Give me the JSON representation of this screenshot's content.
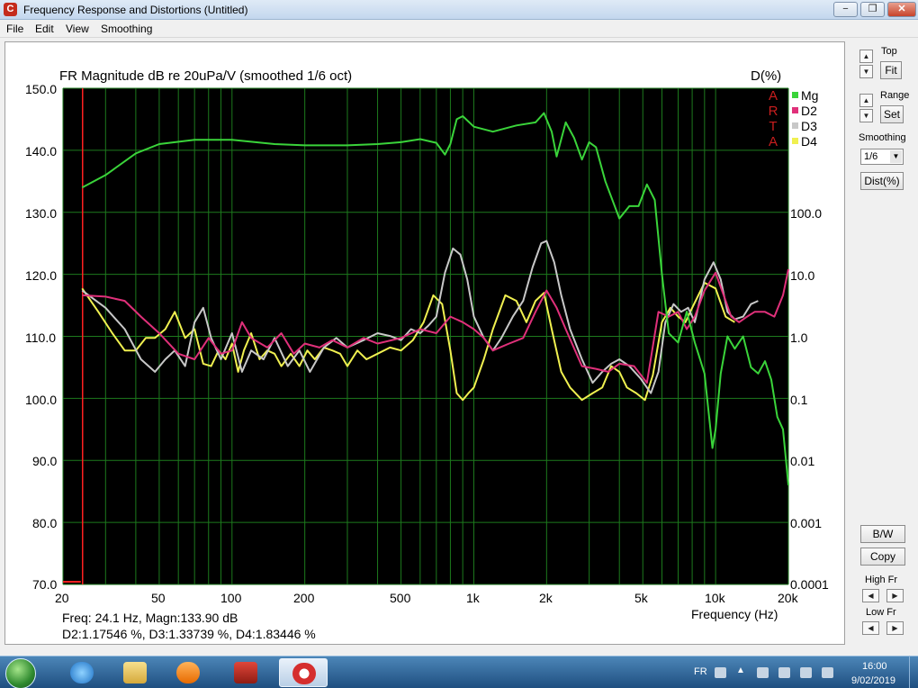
{
  "window": {
    "title": "Frequency Response and Distortions (Untitled)"
  },
  "titlebar_buttons": {
    "minimize": "−",
    "maximize": "❐",
    "close": "✕"
  },
  "menu": [
    "File",
    "Edit",
    "View",
    "Smoothing"
  ],
  "plot": {
    "title": "FR Magnitude dB re 20uPa/V (smoothed 1/6 oct)",
    "right_axis_label": "D(%)",
    "x_axis_label": "Frequency (Hz)",
    "arta_letters": [
      "A",
      "R",
      "T",
      "A"
    ],
    "left_ticks": [
      "150.0",
      "140.0",
      "130.0",
      "120.0",
      "110.0",
      "100.0",
      "90.0",
      "80.0",
      "70.0"
    ],
    "right_ticks": [
      "100.0",
      "10.0",
      "1.0",
      "0.1",
      "0.01",
      "0.001",
      "0.0001"
    ],
    "x_ticks": [
      "20",
      "50",
      "100",
      "200",
      "500",
      "1k",
      "2k",
      "5k",
      "10k",
      "20k"
    ],
    "readout_line1": "Freq: 24.1 Hz, Magn:133.90 dB",
    "readout_line2": "D2:1.17546 %, D3:1.33739 %, D4:1.83446 %",
    "colors": {
      "background": "#000000",
      "grid": "#1d7a1d",
      "cursor": "#ff2020",
      "Mg": "#3ad43a",
      "D2": "#e0307a",
      "D3": "#c8c8c8",
      "D4": "#f0f050"
    }
  },
  "side_panel": {
    "top_label": "Top",
    "fit_button": "Fit",
    "range_label": "Range",
    "set_button": "Set",
    "smoothing_label": "Smoothing",
    "smoothing_value": "1/6",
    "dist_button": "Dist(%)",
    "bw_button": "B/W",
    "copy_button": "Copy",
    "high_fr_label": "High Fr",
    "low_fr_label": "Low Fr"
  },
  "taskbar": {
    "lang": "FR",
    "time": "16:00",
    "date": "9/02/2019"
  },
  "chart_data": {
    "type": "line",
    "title": "FR Magnitude dB re 20uPa/V (smoothed 1/6 oct)",
    "xlabel": "Frequency (Hz)",
    "ylabel": "",
    "y2label": "D(%)",
    "x_scale": "log",
    "xlim": [
      20,
      20000
    ],
    "ylim": [
      70,
      150
    ],
    "y2_scale": "log",
    "y2lim": [
      0.0001,
      1000
    ],
    "grid": true,
    "legend": "top-right",
    "cursor_x": 24.1,
    "series": [
      {
        "name": "Mg",
        "axis": "left",
        "x": [
          24,
          30,
          40,
          50,
          70,
          100,
          150,
          200,
          300,
          400,
          500,
          600,
          700,
          760,
          800,
          850,
          900,
          1000,
          1200,
          1500,
          1800,
          1950,
          2100,
          2200,
          2400,
          2600,
          2800,
          3000,
          3200,
          3500,
          4000,
          4400,
          4800,
          5200,
          5600,
          6000,
          6400,
          7000,
          7600,
          8200,
          9000,
          9700,
          10000,
          10500,
          11200,
          12000,
          13000,
          14000,
          15000,
          16000,
          17000,
          18000,
          19000,
          20000
        ],
        "y": [
          134,
          136,
          139.5,
          141,
          141.7,
          141.7,
          141,
          140.8,
          140.8,
          141,
          141.3,
          141.8,
          141.2,
          139.3,
          141,
          145,
          145.5,
          143.8,
          143,
          144,
          144.5,
          146,
          143,
          139,
          144.5,
          142,
          138.5,
          141.3,
          140.5,
          135,
          129,
          131,
          131,
          134.5,
          132,
          120,
          110.5,
          109,
          114,
          109,
          104,
          92,
          95,
          104,
          110,
          108,
          110,
          105,
          104,
          106,
          103,
          97,
          95,
          86
        ]
      },
      {
        "name": "D2",
        "axis": "right",
        "x": [
          24,
          30,
          36,
          42,
          50,
          60,
          70,
          80,
          90,
          100,
          110,
          120,
          140,
          160,
          180,
          200,
          230,
          260,
          300,
          350,
          400,
          500,
          600,
          700,
          800,
          900,
          1000,
          1100,
          1200,
          1400,
          1600,
          1800,
          2000,
          2200,
          2400,
          2800,
          3200,
          3600,
          4000,
          4600,
          5200,
          5800,
          6400,
          7000,
          7600,
          8200,
          9000,
          10000,
          10800,
          11600,
          12500,
          13500,
          14500,
          16000,
          17500,
          19000,
          20000
        ],
        "y": [
          1.2,
          1.15,
          1.0,
          0.6,
          0.35,
          0.18,
          0.15,
          0.3,
          0.18,
          0.2,
          0.5,
          0.3,
          0.22,
          0.35,
          0.18,
          0.25,
          0.22,
          0.28,
          0.22,
          0.3,
          0.25,
          0.3,
          0.4,
          0.35,
          0.6,
          0.5,
          0.4,
          0.3,
          0.2,
          0.25,
          0.3,
          0.7,
          1.4,
          0.8,
          0.4,
          0.12,
          0.11,
          0.1,
          0.13,
          0.12,
          0.07,
          0.7,
          0.6,
          0.7,
          0.4,
          0.6,
          1.4,
          2.5,
          1.2,
          0.6,
          0.5,
          0.6,
          0.7,
          0.7,
          0.6,
          1.2,
          2.8
        ]
      },
      {
        "name": "D3",
        "axis": "right",
        "x": [
          24,
          30,
          36,
          42,
          48,
          53,
          58,
          64,
          70,
          76,
          82,
          90,
          100,
          110,
          120,
          135,
          150,
          170,
          190,
          210,
          240,
          270,
          300,
          350,
          400,
          450,
          500,
          550,
          600,
          650,
          700,
          760,
          820,
          880,
          940,
          1000,
          1100,
          1200,
          1300,
          1450,
          1600,
          1750,
          1900,
          2000,
          2150,
          2300,
          2500,
          2800,
          3100,
          3400,
          3700,
          4000,
          4400,
          4900,
          5400,
          5800,
          6200,
          6700,
          7200,
          7700,
          8200,
          9000,
          9800,
          10500,
          11200,
          12000,
          13000,
          14000,
          15000
        ],
        "y": [
          1.4,
          0.8,
          0.4,
          0.15,
          0.1,
          0.15,
          0.2,
          0.12,
          0.5,
          0.8,
          0.3,
          0.15,
          0.35,
          0.1,
          0.2,
          0.15,
          0.3,
          0.12,
          0.2,
          0.1,
          0.22,
          0.3,
          0.22,
          0.28,
          0.35,
          0.32,
          0.28,
          0.4,
          0.35,
          0.45,
          0.6,
          2.5,
          5.5,
          4.5,
          2.0,
          0.6,
          0.3,
          0.2,
          0.3,
          0.6,
          1.0,
          3.0,
          6.5,
          7.0,
          3.5,
          1.2,
          0.4,
          0.15,
          0.07,
          0.1,
          0.13,
          0.15,
          0.12,
          0.08,
          0.05,
          0.1,
          0.5,
          0.9,
          0.7,
          0.8,
          0.5,
          2.0,
          3.5,
          2.0,
          0.7,
          0.55,
          0.6,
          0.9,
          1.0
        ]
      },
      {
        "name": "D4",
        "axis": "right",
        "x": [
          24,
          28,
          32,
          36,
          40,
          44,
          48,
          53,
          58,
          64,
          70,
          76,
          82,
          88,
          94,
          100,
          106,
          112,
          120,
          130,
          140,
          150,
          160,
          175,
          190,
          205,
          220,
          240,
          260,
          280,
          300,
          330,
          360,
          400,
          450,
          500,
          560,
          620,
          680,
          740,
          800,
          850,
          900,
          950,
          1000,
          1100,
          1200,
          1350,
          1500,
          1650,
          1800,
          1950,
          2100,
          2300,
          2500,
          2800,
          3100,
          3400,
          3700,
          4000,
          4300,
          4700,
          5100,
          5500,
          6000,
          6500,
          7000,
          7500,
          8000,
          9000,
          10000,
          11000,
          12000
        ],
        "y": [
          1.5,
          0.7,
          0.35,
          0.2,
          0.2,
          0.3,
          0.3,
          0.4,
          0.7,
          0.3,
          0.4,
          0.13,
          0.12,
          0.2,
          0.15,
          0.25,
          0.1,
          0.2,
          0.35,
          0.15,
          0.2,
          0.18,
          0.12,
          0.18,
          0.12,
          0.2,
          0.15,
          0.22,
          0.2,
          0.18,
          0.12,
          0.2,
          0.15,
          0.18,
          0.22,
          0.2,
          0.28,
          0.5,
          1.2,
          0.9,
          0.2,
          0.05,
          0.04,
          0.05,
          0.06,
          0.15,
          0.4,
          1.2,
          1.0,
          0.5,
          1.0,
          1.3,
          0.4,
          0.1,
          0.06,
          0.04,
          0.05,
          0.06,
          0.12,
          0.1,
          0.06,
          0.05,
          0.04,
          0.09,
          0.5,
          0.8,
          0.6,
          0.5,
          0.8,
          1.8,
          1.5,
          0.6,
          0.5
        ]
      }
    ]
  }
}
